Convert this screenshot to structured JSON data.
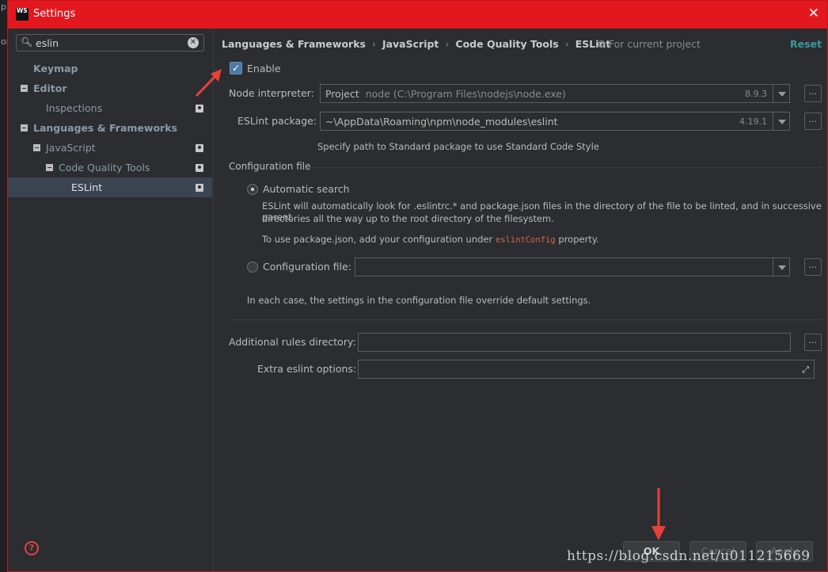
{
  "window": {
    "title": "Settings",
    "logo": "WS",
    "close_glyph": "✕"
  },
  "outer_edge": {
    "a": "p",
    "b": "or"
  },
  "search": {
    "value": "eslin",
    "clear_glyph": "✕"
  },
  "tree": [
    {
      "label": "Keymap"
    },
    {
      "label": "Editor"
    },
    {
      "label": "Inspections"
    },
    {
      "label": "Languages & Frameworks"
    },
    {
      "label": "JavaScript"
    },
    {
      "label": "Code Quality Tools"
    },
    {
      "label": "ESLint"
    }
  ],
  "breadcrumb": {
    "items": [
      "Languages & Frameworks",
      "JavaScript",
      "Code Quality Tools",
      "ESLint"
    ],
    "separator": "›"
  },
  "scope": "For current project",
  "reset_label": "Reset",
  "enable": {
    "label": "Enable",
    "checked": true
  },
  "node_interpreter": {
    "label": "Node interpreter:",
    "prefix": "Project",
    "value": "node (C:\\Program Files\\nodejs\\node.exe)",
    "version": "8.9.3"
  },
  "eslint_package": {
    "label": "ESLint package:",
    "value": "~\\AppData\\Roaming\\npm\\node_modules\\eslint",
    "version": "4.19.1"
  },
  "standard_hint": "Specify path to Standard package to use Standard Code Style",
  "config_section": {
    "title": "Configuration file",
    "auto_label": "Automatic search",
    "auto_desc_1": "ESLint will automatically look for .eslintrc.* and package.json files in the directory of the file to be linted, and in successive parent",
    "auto_desc_2": "directories all the way up to the root directory of the filesystem.",
    "pkg_prefix": "To use package.json, add your configuration under",
    "pkg_code": "eslintConfig",
    "pkg_suffix": "property.",
    "file_label": "Configuration file:",
    "override_note": "In each case, the settings in the configuration file override default settings."
  },
  "additional_rules": {
    "label": "Additional rules directory:"
  },
  "extra_options": {
    "label": "Extra eslint options:"
  },
  "buttons": {
    "ok": "OK",
    "cancel": "Cancel",
    "apply": "Apply"
  },
  "help_glyph": "?",
  "ellipsis": "...",
  "watermark": "https://blog.csdn.net/u011215669",
  "colors": {
    "titlebar": "#e3181f",
    "accent": "#3a9b9e",
    "annotation_arrow": "#e8413a"
  }
}
